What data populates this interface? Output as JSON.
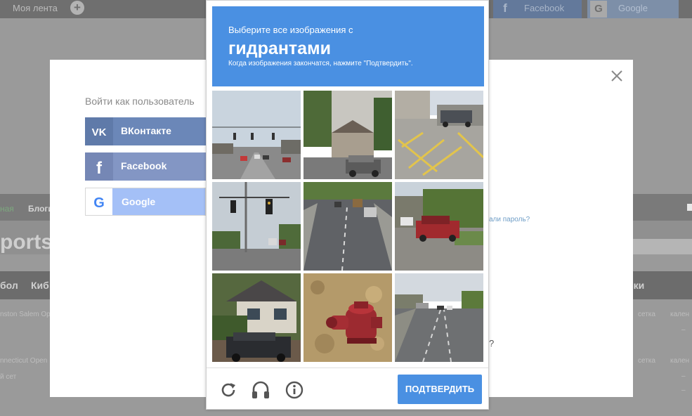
{
  "topbar": {
    "feed_label": "Моя лента",
    "facebook_label": "Facebook",
    "google_label": "Google"
  },
  "background": {
    "nav_home": "ная",
    "nav_blogs": "Блоги",
    "big_title": "ports",
    "rub_1": "бол",
    "rub_2": "Киб",
    "rub_3": "вки",
    "row_1": "nston Salem Open",
    "row_2": "nnecticut Open",
    "row_3": "й сет",
    "grid_1": "сетка",
    "grid_2": "сетка",
    "cal_1": "кален",
    "cal_2": "кален",
    "dash_1": "–",
    "dash_2": "–",
    "dash_3": "–"
  },
  "login": {
    "heading": "Войти как пользователь",
    "vk_label": "ВКонтакте",
    "facebook_label": "Facebook",
    "google_label": "Google",
    "forgot_text": "али пароль?",
    "question_mark": "?"
  },
  "captcha": {
    "instruction_line1": "Выберите все изображения с",
    "target_object": "гидрантами",
    "instruction_line2": "Когда изображения закончатся, нажмите \"Подтвердить\".",
    "verify_button": "ПОДТВЕРДИТЬ",
    "tiles": [
      {
        "name": "tile-street-intersection"
      },
      {
        "name": "tile-street-houses"
      },
      {
        "name": "tile-parking-lot"
      },
      {
        "name": "tile-traffic-lights"
      },
      {
        "name": "tile-road-trucks"
      },
      {
        "name": "tile-red-car"
      },
      {
        "name": "tile-house-car"
      },
      {
        "name": "tile-fire-hydrant"
      },
      {
        "name": "tile-highway"
      }
    ],
    "icons": [
      "reload-icon",
      "headphones-icon",
      "info-icon"
    ]
  },
  "colors": {
    "captcha_blue": "#4a90e2",
    "vk": "#6b87b8",
    "facebook": "#8396c4",
    "google": "#a4c0f7"
  }
}
